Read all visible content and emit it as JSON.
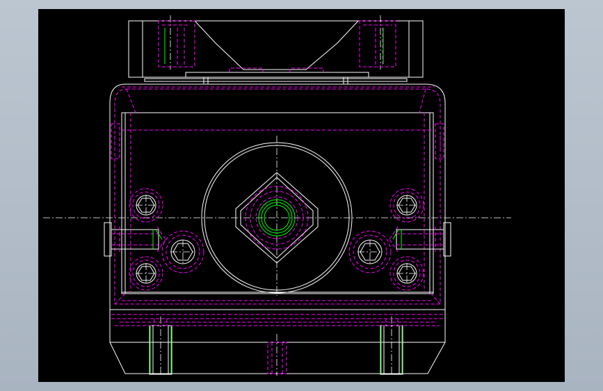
{
  "viewer": {
    "background_frame": "#b4bfcb",
    "canvas_background": "#000000"
  },
  "drawing": {
    "subject": "cylinder-mounting-block-front-view",
    "colors": {
      "outline": "#ffffff",
      "hidden": "#ff00ff",
      "thread": "#00ff00",
      "centerline": "#ffffff"
    },
    "bolt_holes": 6,
    "threaded_inserts": 4
  }
}
